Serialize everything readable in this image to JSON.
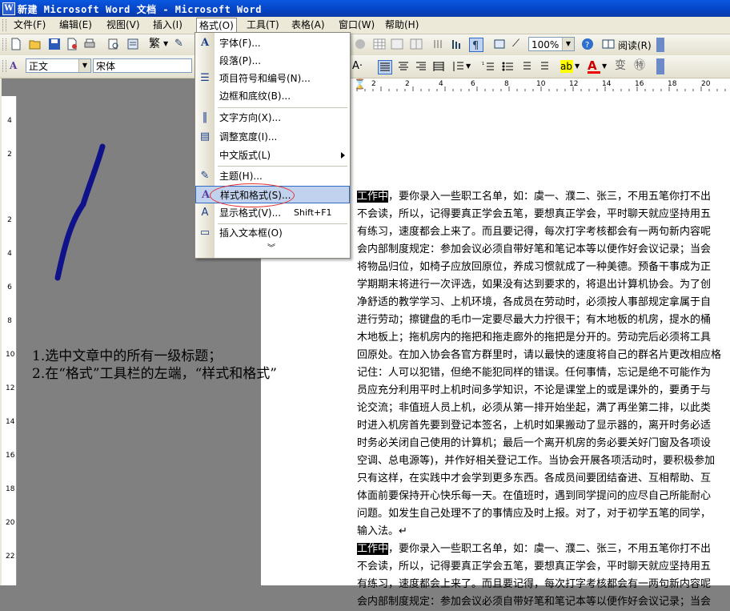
{
  "window": {
    "title": "新建 Microsoft Word 文档 - Microsoft Word",
    "icon": "word-doc-icon"
  },
  "menubar": {
    "items": [
      "文件(F)",
      "编辑(E)",
      "视图(V)",
      "插入(I)",
      "格式(O)",
      "工具(T)",
      "表格(A)",
      "窗口(W)",
      "帮助(H)"
    ],
    "open_item": "格式(O)"
  },
  "toolbar_standard": {
    "zoom": "100%",
    "read_label": "阅读(R)"
  },
  "toolbar_format": {
    "style": "正文",
    "font": "宋体"
  },
  "format_menu": {
    "items": [
      {
        "label": "字体(F)...",
        "icon": "font-A-icon"
      },
      {
        "label": "段落(P)...",
        "icon": ""
      },
      {
        "label": "项目符号和编号(N)...",
        "icon": "bullets-icon"
      },
      {
        "label": "边框和底纹(B)...",
        "icon": ""
      },
      {
        "label": "文字方向(X)...",
        "icon": "text-direction-icon"
      },
      {
        "label": "调整宽度(I)...",
        "icon": "adjust-width-icon"
      },
      {
        "label": "中文版式(L)",
        "icon": ""
      },
      {
        "label": "主题(H)...",
        "icon": "theme-icon"
      },
      {
        "label": "样式和格式(S)...",
        "icon": "styles-icon"
      },
      {
        "label": "显示格式(V)...",
        "icon": "reveal-formatting-icon",
        "accel": "Shift+F1"
      },
      {
        "label": "插入文本框(O)",
        "icon": "textbox-icon"
      }
    ],
    "expand_icon": "expand-chevron-icon",
    "highlighted": "样式和格式(S)..."
  },
  "annotation": {
    "line1": "1.选中文章中的所有一级标题；",
    "line2": "2.在“格式”工具栏的左端，“样式和格式”"
  },
  "document": {
    "lines": [
      {
        "hl": "工作中",
        "text": "，要你录入一些职工名单，如：虞一、濮二、张三，不用五笔你打不出"
      },
      {
        "hl": "",
        "text": "不会读，所以，记得要真正学会五笔，要想真正学会，平时聊天就应坚持用五"
      },
      {
        "hl": "",
        "text": "有练习，速度都会上来了。而且要记得，每次打字考核都会有一两句新内容呢"
      },
      {
        "hl": "",
        "text": "会内部制度规定：参加会议必须自带好笔和笔记本等以便作好会议记录；当会"
      },
      {
        "hl": "",
        "text": "将物品归位，如椅子应放回原位，养成习惯就成了一种美德。预备干事成为正"
      },
      {
        "hl": "",
        "text": "学期期末将进行一次评选，如果没有达到要求的，将退出计算机协会。为了创"
      },
      {
        "hl": "",
        "text": "净舒适的教学学习、上机环境，各成员在劳动时，必须按人事部规定拿属于自"
      },
      {
        "hl": "",
        "text": "进行劳动；擦键盘的毛巾一定要尽最大力拧很干；有木地板的机房，提水的桶"
      },
      {
        "hl": "",
        "text": "木地板上；拖机房内的拖把和拖走廊外的拖把是分开的。劳动完后必须将工具"
      },
      {
        "hl": "",
        "text": "回原处。在加入协会各官方群里时，请以最快的速度将自己的群名片更改相应格"
      },
      {
        "hl": "",
        "text": "记住：人可以犯错，但绝不能犯同样的错误。任何事情，忘记是绝不可能作为"
      },
      {
        "hl": "",
        "text": "员应充分利用平时上机时间多学知识，不论是课堂上的或是课外的，要勇于与"
      },
      {
        "hl": "",
        "text": "论交流；非值班人员上机，必须从第一排开始坐起，满了再坐第二排，以此类"
      },
      {
        "hl": "",
        "text": "时进入机房首先要到登记本签名，上机时如果搬动了显示器的，离开时务必适"
      },
      {
        "hl": "",
        "text": "时务必关闭自己使用的计算机；最后一个离开机房的务必要关好门窗及各项设"
      },
      {
        "hl": "",
        "text": "空调、总电源等)，并作好相关登记工作。当协会开展各项活动时，要积极参加"
      },
      {
        "hl": "",
        "text": "只有这样，在实践中才会学到更多东西。各成员间要团结奋进、互相帮助、互"
      },
      {
        "hl": "",
        "text": "体面前要保持开心快乐每一天。在值班时，遇到同学提问的应尽自己所能耐心"
      },
      {
        "hl": "",
        "text": "问题。如发生自己处理不了的事情应及时上报。对了，对于初学五笔的同学，"
      },
      {
        "hl": "",
        "text": "输入法。↵"
      },
      {
        "hl": "工作中",
        "text": "，要你录入一些职工名单，如：虞一、濮二、张三，不用五笔你打不出"
      },
      {
        "hl": "",
        "text": "不会读，所以，记得要真正学会五笔，要想真正学会，平时聊天就应坚持用五"
      },
      {
        "hl": "",
        "text": "有练习，速度都会上来了。而且要记得，每次打字考核都会有一两句新内容呢"
      },
      {
        "hl": "",
        "text": "会内部制度规定：参加会议必须自带好笔和笔记本等以便作好会议记录；当会"
      }
    ]
  },
  "ruler_h_numbers": [
    "2",
    "2",
    "4",
    "6",
    "8",
    "10",
    "12",
    "14",
    "16",
    "18",
    "20"
  ],
  "ruler_v_numbers": [
    "4",
    "2",
    "2",
    "4",
    "6",
    "8",
    "10",
    "12",
    "14",
    "16",
    "18",
    "20",
    "22"
  ]
}
